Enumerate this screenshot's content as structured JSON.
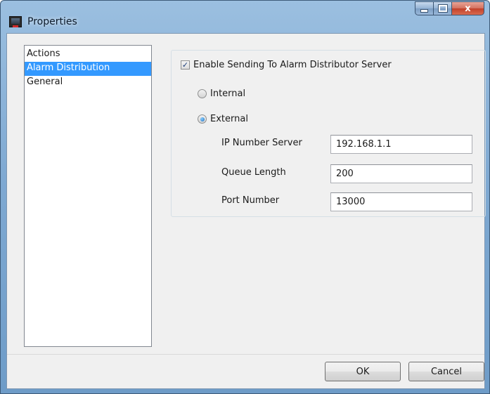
{
  "window": {
    "title": "Properties",
    "icon": "app-window-icon",
    "caption_buttons": {
      "close": "x"
    }
  },
  "nav": {
    "items": [
      {
        "label": "Actions",
        "selected": false
      },
      {
        "label": "Alarm Distribution",
        "selected": true
      },
      {
        "label": "General",
        "selected": false
      }
    ]
  },
  "panel": {
    "enable_label": "Enable Sending To Alarm Distributor Server",
    "enable_checked": true,
    "internal_label": "Internal",
    "internal_selected": false,
    "external_label": "External",
    "external_selected": true,
    "fields": {
      "ip_label": "IP Number Server",
      "ip_value": "192.168.1.1",
      "queue_label": "Queue Length",
      "queue_value": "200",
      "port_label": "Port Number",
      "port_value": "13000"
    }
  },
  "buttons": {
    "ok": "OK",
    "cancel": "Cancel"
  },
  "colors": {
    "selection": "#3399ff",
    "frame": "#7fa9d2",
    "client_bg": "#f0f0f0"
  }
}
